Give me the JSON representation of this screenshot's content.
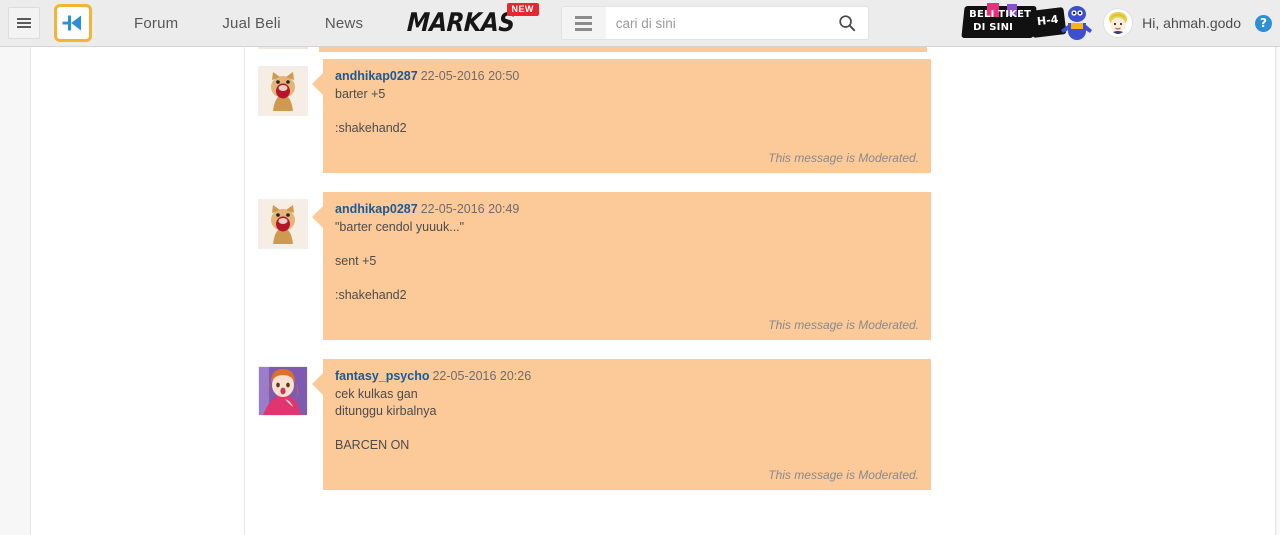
{
  "header": {
    "menu_icon": "hamburger-icon",
    "logo_letter": "K",
    "nav": [
      {
        "label": "Forum"
      },
      {
        "label": "Jual Beli"
      },
      {
        "label": "News"
      }
    ],
    "markas": {
      "label": "MARKAS",
      "badge": "NEW"
    },
    "search": {
      "category_icon": "menu-lines-icon",
      "placeholder": "cari di sini",
      "value": "",
      "search_icon": "search-icon"
    },
    "ad": {
      "line1": "BELI TIKET",
      "line2": "DI SINI",
      "line3": "H-4",
      "alt": "beli-tiket-di-sini-banner"
    },
    "user": {
      "greeting": "Hi, ahmah.godo",
      "avatar_alt": "user-avatar",
      "help_label": "?"
    }
  },
  "colors": {
    "bubble": "#fcc999",
    "username_link": "#1a5a94",
    "header_bg": "#ececec",
    "logo_border": "#f5b335",
    "logo_blue": "#2f8fd6",
    "badge_red": "#e8262d",
    "moderated_text": "#8a8a8a"
  },
  "thread": {
    "moderated_note": "This message is Moderated.",
    "posts": [
      {
        "username": "andhikap0287",
        "timestamp": "22-05-2016 20:50",
        "body": "barter +5\n\n:shakehand2",
        "avatar": "cat-avatar",
        "moderated": "This message is Moderated."
      },
      {
        "username": "andhikap0287",
        "timestamp": "22-05-2016 20:49",
        "body": "\"barter cendol yuuuk...\"\n\nsent +5\n\n:shakehand2",
        "avatar": "cat-avatar",
        "moderated": "This message is Moderated."
      },
      {
        "username": "fantasy_psycho",
        "timestamp": "22-05-2016 20:26",
        "body": "cek kulkas gan\nditunggu kirbalnya\n\nBARCEN ON",
        "avatar": "anime-avatar",
        "moderated": "This message is Moderated."
      }
    ]
  }
}
